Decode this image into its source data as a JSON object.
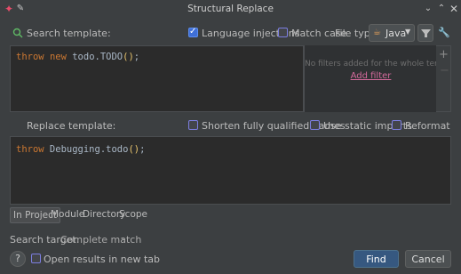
{
  "window": {
    "title": "Structural Replace",
    "pin_icon": "pin-icon",
    "app_icon": "intellij-icon",
    "controls": [
      "chevron-down-icon",
      "chevron-up-icon",
      "close-icon"
    ]
  },
  "search": {
    "label": "Search template:",
    "icon": "search-template-icon",
    "language_injections": {
      "label": "Language injections",
      "checked": true
    },
    "match_case": {
      "label": "Match case",
      "checked": false
    },
    "file_type_label": "File type:",
    "file_type_value": "Java",
    "code": {
      "kw1": "throw",
      "kw2": "new",
      "rest": " todo.TODO",
      "parens": "()",
      "semi": ";"
    }
  },
  "filters": {
    "empty_text": "No filters added for the whole template",
    "add_filter": "Add filter",
    "add_icon": "plus-icon",
    "remove_icon": "minus-icon"
  },
  "replace": {
    "label": "Replace template:",
    "shorten_fqn": {
      "label": "Shorten fully qualified names",
      "checked": false
    },
    "static_imports": {
      "label": "Use static imports",
      "checked": false
    },
    "reformat": {
      "label": "Reformat",
      "checked": false
    },
    "code": {
      "kw1": "throw",
      "rest": " Debugging.todo",
      "parens": "()",
      "semi": ";"
    }
  },
  "scope": {
    "tabs": [
      "In Project",
      "Module",
      "Directory",
      "Scope"
    ],
    "selected": "In Project"
  },
  "search_target": {
    "label": "Search target:",
    "value": "Complete match"
  },
  "footer": {
    "open_in_new_tab": {
      "label": "Open results in new tab",
      "checked": false
    },
    "find_button": "Find",
    "cancel_button": "Cancel"
  },
  "colors": {
    "background": "#3c3f41",
    "editor": "#2b2b2b",
    "keyword": "#cc7832",
    "accent": "#365880",
    "link": "#d36a9b"
  }
}
